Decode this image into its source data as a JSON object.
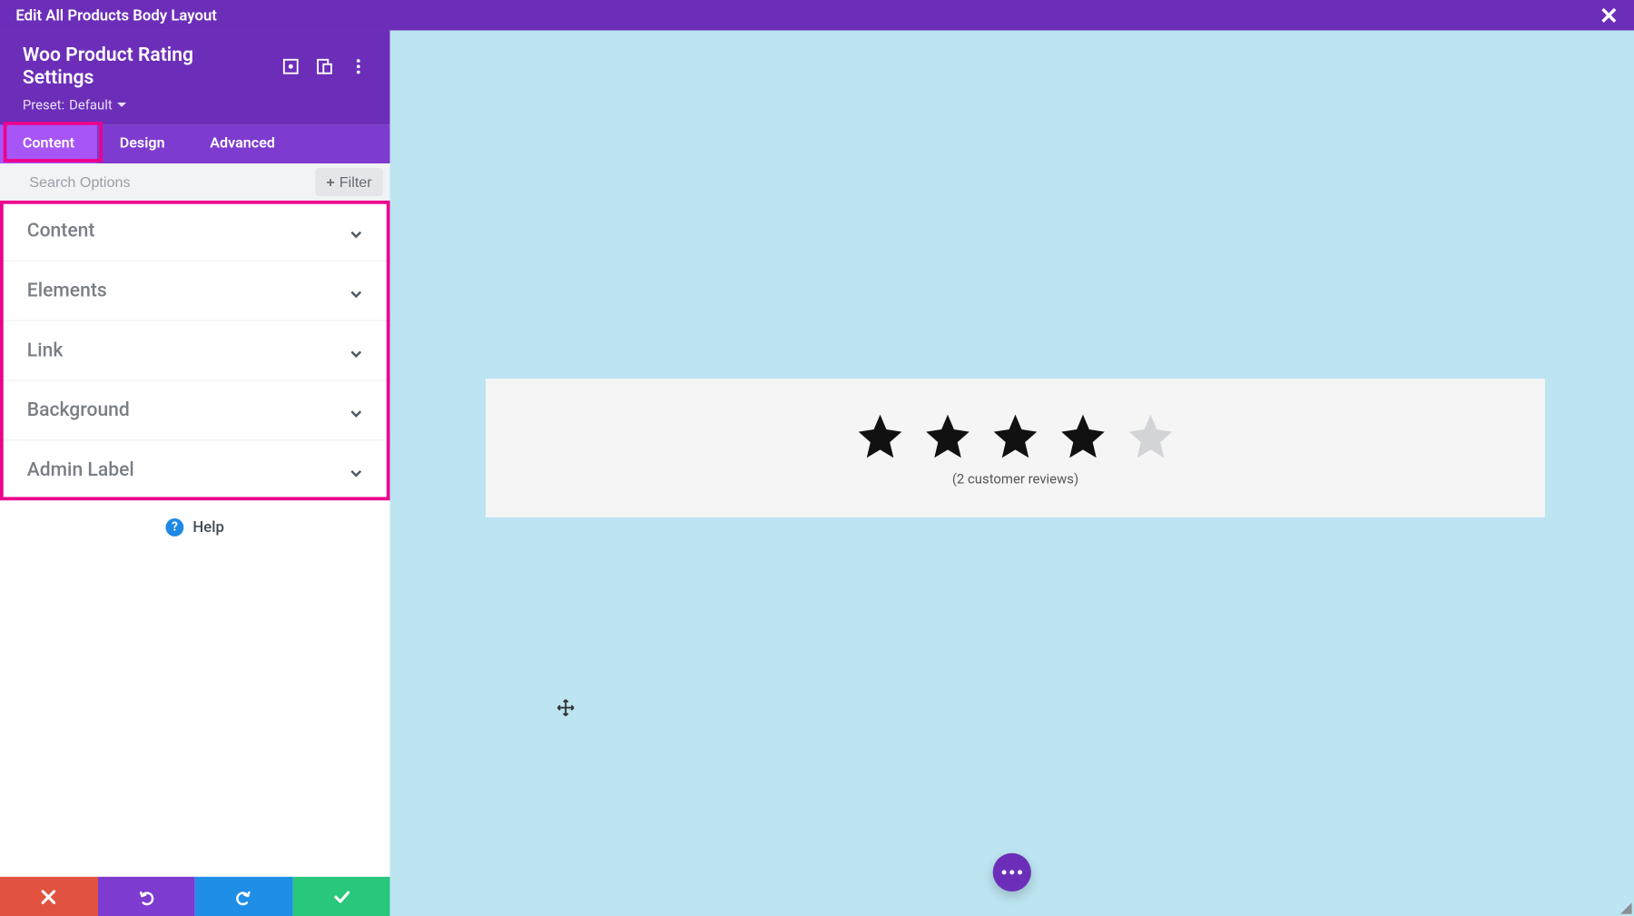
{
  "topbar": {
    "title": "Edit All Products Body Layout"
  },
  "sidebar": {
    "module_title": "Woo Product Rating Settings",
    "preset_label": "Preset:",
    "preset_value": "Default",
    "tabs": {
      "content": "Content",
      "design": "Design",
      "advanced": "Advanced"
    },
    "search_placeholder": "Search Options",
    "filter_label": "Filter",
    "accordions": {
      "content": "Content",
      "elements": "Elements",
      "link": "Link",
      "background": "Background",
      "admin_label": "Admin Label"
    },
    "help_label": "Help"
  },
  "canvas": {
    "rating": {
      "stars_filled": 4,
      "stars_total": 5,
      "reviews_text": "(2 customer reviews)"
    }
  },
  "colors": {
    "purple": "#6c2eb9",
    "purple_light": "#7e3bd0",
    "tab_active": "#a855f7",
    "highlight_pink": "#ec008c",
    "canvas_bg": "#bce4f1",
    "red": "#e15241",
    "blue": "#1f8ee6",
    "green": "#28c77b"
  }
}
